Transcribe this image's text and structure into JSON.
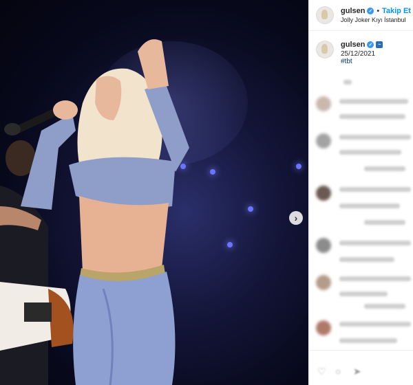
{
  "post": {
    "username": "gulsen",
    "follow_label": "Takip Et",
    "separator": "•",
    "location": "Jolly Joker Kıyı İstanbul"
  },
  "caption": {
    "username": "gulsen",
    "date": "25/12/2021",
    "hashtag": "#tbt"
  },
  "icons": {
    "verified": "verified-badge-icon",
    "next": "chevron-right-icon",
    "caption_emoji": "dolphin-emoji-icon",
    "like": "heart-icon",
    "comment": "comment-icon",
    "share": "share-icon"
  },
  "colors": {
    "accent": "#0095f6",
    "verified": "#3897f0",
    "hashtag": "#00376b",
    "text": "#262626"
  }
}
